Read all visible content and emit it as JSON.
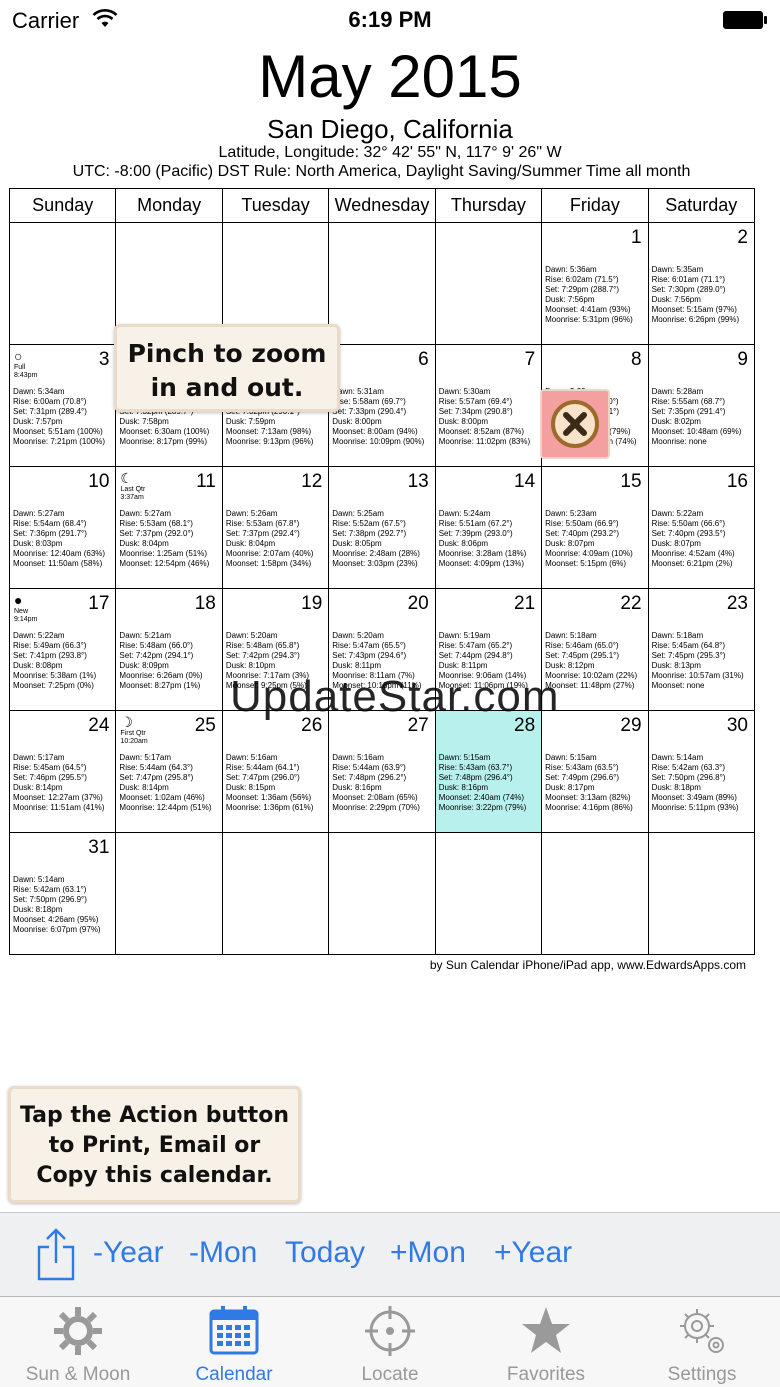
{
  "status": {
    "carrier": "Carrier",
    "time": "6:19 PM"
  },
  "header": {
    "title": "May 2015",
    "location": "San Diego, California",
    "latlon": "Latitude, Longitude: 32° 42' 55\" N, 117° 9' 26\" W",
    "utc": "UTC: -8:00 (Pacific)   DST Rule: North America, Daylight Saving/Summer Time all month"
  },
  "calendar": {
    "weekdays": [
      "Sunday",
      "Monday",
      "Tuesday",
      "Wednesday",
      "Thursday",
      "Friday",
      "Saturday"
    ],
    "today": 28,
    "days": [
      null,
      null,
      null,
      null,
      null,
      {
        "day": "1",
        "lines": [
          "Dawn: 5:36am",
          "Rise: 6:02am (71.5°)",
          "Set: 7:29pm (288.7°)",
          "Dusk: 7:56pm",
          "Moonset: 4:41am (93%)",
          "Moonrise: 5:31pm (96%)"
        ]
      },
      {
        "day": "2",
        "lines": [
          "Dawn: 5:35am",
          "Rise: 6:01am (71.1°)",
          "Set: 7:30pm (289.0°)",
          "Dusk: 7:56pm",
          "Moonset: 5:15am (97%)",
          "Moonrise: 6:26pm (99%)"
        ]
      },
      {
        "day": "3",
        "phase": {
          "glyph": "○",
          "name": "Full",
          "time": "8:43pm"
        },
        "lines": [
          "Dawn: 5:34am",
          "Rise: 6:00am (70.8°)",
          "Set: 7:31pm (289.4°)",
          "Dusk: 7:57pm",
          "Moonset: 5:51am (100%)",
          "Moonrise: 7:21pm (100%)"
        ]
      },
      {
        "day": "4",
        "lines": [
          "Dawn: 5:33am",
          "Rise: 5:59am (70.4°)",
          "Set: 7:32pm (289.7°)",
          "Dusk: 7:58pm",
          "Moonset: 6:30am (100%)",
          "Moonrise: 8:17pm (99%)"
        ]
      },
      {
        "day": "5",
        "lines": [
          "Dawn: 5:32am",
          "Rise: 5:58am (70.1°)",
          "Set: 7:32pm (290.1°)",
          "Dusk: 7:59pm",
          "Moonset: 7:13am (98%)",
          "Moonrise: 9:13pm (96%)"
        ]
      },
      {
        "day": "6",
        "lines": [
          "Dawn: 5:31am",
          "Rise: 5:58am (69.7°)",
          "Set: 7:33pm (290.4°)",
          "Dusk: 8:00pm",
          "Moonset: 8:00am (94%)",
          "Moonrise: 10:09pm (90%)"
        ]
      },
      {
        "day": "7",
        "lines": [
          "Dawn: 5:30am",
          "Rise: 5:57am (69.4°)",
          "Set: 7:34pm (290.8°)",
          "Dusk: 8:00pm",
          "Moonset: 8:52am (87%)",
          "Moonrise: 11:02pm (83%)"
        ]
      },
      {
        "day": "8",
        "lines": [
          "Dawn: 5:29am",
          "Rise: 5:56am (69.0°)",
          "Set: 7:35pm (291.1°)",
          "Dusk: 8:01pm",
          "Moonset: 9:48am (79%)",
          "Moonrise: 11:53pm (74%)"
        ]
      },
      {
        "day": "9",
        "lines": [
          "Dawn: 5:28am",
          "Rise: 5:55am (68.7°)",
          "Set: 7:35pm (291.4°)",
          "Dusk: 8:02pm",
          "Moonset: 10:48am (69%)",
          "Moonrise: none"
        ]
      },
      {
        "day": "10",
        "lines": [
          "Dawn: 5:27am",
          "Rise: 5:54am (68.4°)",
          "Set: 7:36pm (291.7°)",
          "Dusk: 8:03pm",
          "Moonrise: 12:40am (63%)",
          "Moonset: 11:50am (58%)"
        ]
      },
      {
        "day": "11",
        "phase": {
          "glyph": "☾",
          "name": "Last Qtr",
          "time": "3:37am"
        },
        "lines": [
          "Dawn: 5:27am",
          "Rise: 5:53am (68.1°)",
          "Set: 7:37pm (292.0°)",
          "Dusk: 8:04pm",
          "Moonrise: 1:25am (51%)",
          "Moonset: 12:54pm (46%)"
        ]
      },
      {
        "day": "12",
        "lines": [
          "Dawn: 5:26am",
          "Rise: 5:53am (67.8°)",
          "Set: 7:37pm (292.4°)",
          "Dusk: 8:04pm",
          "Moonrise: 2:07am (40%)",
          "Moonset: 1:58pm (34%)"
        ]
      },
      {
        "day": "13",
        "lines": [
          "Dawn: 5:25am",
          "Rise: 5:52am (67.5°)",
          "Set: 7:38pm (292.7°)",
          "Dusk: 8:05pm",
          "Moonrise: 2:48am (28%)",
          "Moonset: 3:03pm (23%)"
        ]
      },
      {
        "day": "14",
        "lines": [
          "Dawn: 5:24am",
          "Rise: 5:51am (67.2°)",
          "Set: 7:39pm (293.0°)",
          "Dusk: 8:06pm",
          "Moonrise: 3:28am (18%)",
          "Moonset: 4:09pm (13%)"
        ]
      },
      {
        "day": "15",
        "lines": [
          "Dawn: 5:23am",
          "Rise: 5:50am (66.9°)",
          "Set: 7:40pm (293.2°)",
          "Dusk: 8:07pm",
          "Moonrise: 4:09am (10%)",
          "Moonset: 5:15pm (6%)"
        ]
      },
      {
        "day": "16",
        "lines": [
          "Dawn: 5:22am",
          "Rise: 5:50am (66.6°)",
          "Set: 7:40pm (293.5°)",
          "Dusk: 8:07pm",
          "Moonrise: 4:52am (4%)",
          "Moonset: 6:21pm (2%)"
        ]
      },
      {
        "day": "17",
        "phase": {
          "glyph": "●",
          "name": "New",
          "time": "9:14pm"
        },
        "lines": [
          "Dawn: 5:22am",
          "Rise: 5:49am (66.3°)",
          "Set: 7:41pm (293.8°)",
          "Dusk: 8:08pm",
          "Moonrise: 5:38am (1%)",
          "Moonset: 7:25pm (0%)"
        ]
      },
      {
        "day": "18",
        "lines": [
          "Dawn: 5:21am",
          "Rise: 5:48am (66.0°)",
          "Set: 7:42pm (294.1°)",
          "Dusk: 8:09pm",
          "Moonrise: 6:26am (0%)",
          "Moonset: 8:27pm (1%)"
        ]
      },
      {
        "day": "19",
        "lines": [
          "Dawn: 5:20am",
          "Rise: 5:48am (65.8°)",
          "Set: 7:42pm (294.3°)",
          "Dusk: 8:10pm",
          "Moonrise: 7:17am (3%)",
          "Moonset: 9:25pm (5%)"
        ]
      },
      {
        "day": "20",
        "lines": [
          "Dawn: 5:20am",
          "Rise: 5:47am (65.5°)",
          "Set: 7:43pm (294.6°)",
          "Dusk: 8:11pm",
          "Moonrise: 8:11am (7%)",
          "Moonset: 10:18pm (11%)"
        ]
      },
      {
        "day": "21",
        "lines": [
          "Dawn: 5:19am",
          "Rise: 5:47am (65.2°)",
          "Set: 7:44pm (294.8°)",
          "Dusk: 8:11pm",
          "Moonrise: 9:06am (14%)",
          "Moonset: 11:06pm (19%)"
        ]
      },
      {
        "day": "22",
        "lines": [
          "Dawn: 5:18am",
          "Rise: 5:46am (65.0°)",
          "Set: 7:45pm (295.1°)",
          "Dusk: 8:12pm",
          "Moonrise: 10:02am (22%)",
          "Moonset: 11:48pm (27%)"
        ]
      },
      {
        "day": "23",
        "lines": [
          "Dawn: 5:18am",
          "Rise: 5:45am (64.8°)",
          "Set: 7:45pm (295.3°)",
          "Dusk: 8:13pm",
          "Moonrise: 10:57am (31%)",
          "Moonset: none"
        ]
      },
      {
        "day": "24",
        "lines": [
          "Dawn: 5:17am",
          "Rise: 5:45am (64.5°)",
          "Set: 7:46pm (295.5°)",
          "Dusk: 8:14pm",
          "Moonset: 12:27am (37%)",
          "Moonrise: 11:51am (41%)"
        ]
      },
      {
        "day": "25",
        "phase": {
          "glyph": "☽",
          "name": "First Qtr",
          "time": "10:20am"
        },
        "lines": [
          "Dawn: 5:17am",
          "Rise: 5:44am (64.3°)",
          "Set: 7:47pm (295.8°)",
          "Dusk: 8:14pm",
          "Moonset: 1:02am (46%)",
          "Moonrise: 12:44pm (51%)"
        ]
      },
      {
        "day": "26",
        "lines": [
          "Dawn: 5:16am",
          "Rise: 5:44am (64.1°)",
          "Set: 7:47pm (296.0°)",
          "Dusk: 8:15pm",
          "Moonset: 1:36am (56%)",
          "Moonrise: 1:36pm (61%)"
        ]
      },
      {
        "day": "27",
        "lines": [
          "Dawn: 5:16am",
          "Rise: 5:44am (63.9°)",
          "Set: 7:48pm (296.2°)",
          "Dusk: 8:16pm",
          "Moonset: 2:08am (65%)",
          "Moonrise: 2:29pm (70%)"
        ]
      },
      {
        "day": "28",
        "lines": [
          "Dawn: 5:15am",
          "Rise: 5:43am (63.7°)",
          "Set: 7:48pm (296.4°)",
          "Dusk: 8:16pm",
          "Moonset: 2:40am (74%)",
          "Moonrise: 3:22pm (79%)"
        ]
      },
      {
        "day": "29",
        "lines": [
          "Dawn: 5:15am",
          "Rise: 5:43am (63.5°)",
          "Set: 7:49pm (296.6°)",
          "Dusk: 8:17pm",
          "Moonset: 3:13am (82%)",
          "Moonrise: 4:16pm (86%)"
        ]
      },
      {
        "day": "30",
        "lines": [
          "Dawn: 5:14am",
          "Rise: 5:42am (63.3°)",
          "Set: 7:50pm (296.8°)",
          "Dusk: 8:18pm",
          "Moonset: 3:49am (89%)",
          "Moonrise: 5:11pm (93%)"
        ]
      },
      {
        "day": "31",
        "lines": [
          "Dawn: 5:14am",
          "Rise: 5:42am (63.1°)",
          "Set: 7:50pm (296.9°)",
          "Dusk: 8:18pm",
          "Moonset: 4:26am (95%)",
          "Moonrise: 6:07pm (97%)"
        ]
      },
      null,
      null,
      null,
      null,
      null,
      null
    ]
  },
  "credit": "by Sun Calendar iPhone/iPad app, www.EdwardsApps.com",
  "tips": {
    "zoom_line1": "Pinch to zoom",
    "zoom_line2": "in and out.",
    "action_line1": "Tap the Action button",
    "action_line2": "to Print, Email or",
    "action_line3": "Copy this calendar."
  },
  "watermark": "UpdateStar.com",
  "actions": {
    "prev_year": "-Year",
    "prev_month": "-Mon",
    "today": "Today",
    "next_month": "+Mon",
    "next_year": "+Year"
  },
  "tabs": [
    {
      "label": "Sun & Moon",
      "icon": "sun-icon",
      "active": false
    },
    {
      "label": "Calendar",
      "icon": "calendar-icon",
      "active": true
    },
    {
      "label": "Locate",
      "icon": "crosshair-icon",
      "active": false
    },
    {
      "label": "Favorites",
      "icon": "star-icon",
      "active": false
    },
    {
      "label": "Settings",
      "icon": "gear-icon",
      "active": false
    }
  ],
  "colors": {
    "accent": "#2f7ae5",
    "today_cell": "#b8f0ee",
    "inactive_tab": "#999999"
  }
}
